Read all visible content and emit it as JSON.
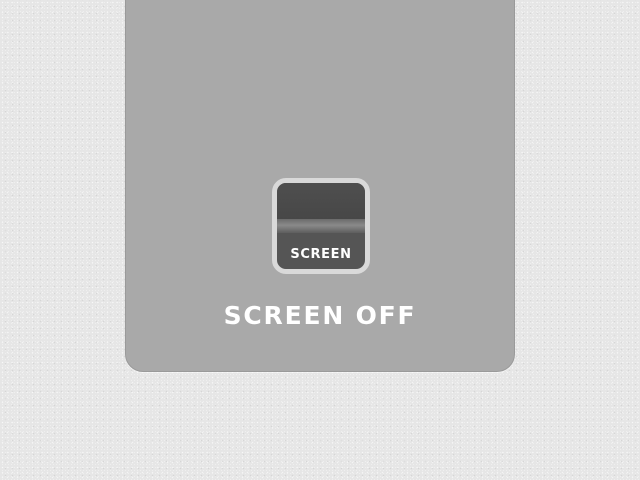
{
  "screen_toggle": {
    "label": "SCREEN",
    "icon": "screen-toggle-icon"
  },
  "status": {
    "text": "SCREEN OFF"
  },
  "colors": {
    "background": "#e6e6e6",
    "panel": "#a9a9a9",
    "button_face": "#555555",
    "button_border": "#d9d9d9",
    "text": "#ffffff"
  }
}
